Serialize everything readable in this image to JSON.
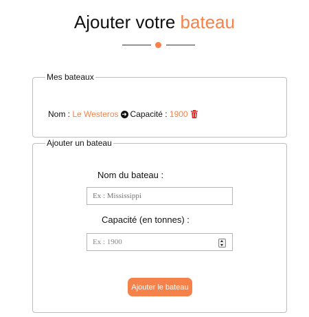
{
  "header": {
    "title_prefix": "Ajouter votre",
    "title_accent": "bateau"
  },
  "colors": {
    "accent": "#f4824a"
  },
  "my_boats": {
    "legend": "Mes bateaux",
    "boat": {
      "name_label": "Nom :",
      "name": "Le Westeros",
      "arrow_icon": "circle-arrow-right-icon",
      "capacity_label": "Capacité :",
      "capacity": "1900",
      "delete_icon": "trash-icon"
    }
  },
  "add_boat": {
    "legend": "Ajouter un bateau",
    "name_label": "Nom du bateau :",
    "name_placeholder": "Ex : Mississippi",
    "capacity_label": "Capacité (en tonnes) :",
    "capacity_placeholder": "Ex : 1900",
    "submit_label": "Ajouter le bateau"
  }
}
